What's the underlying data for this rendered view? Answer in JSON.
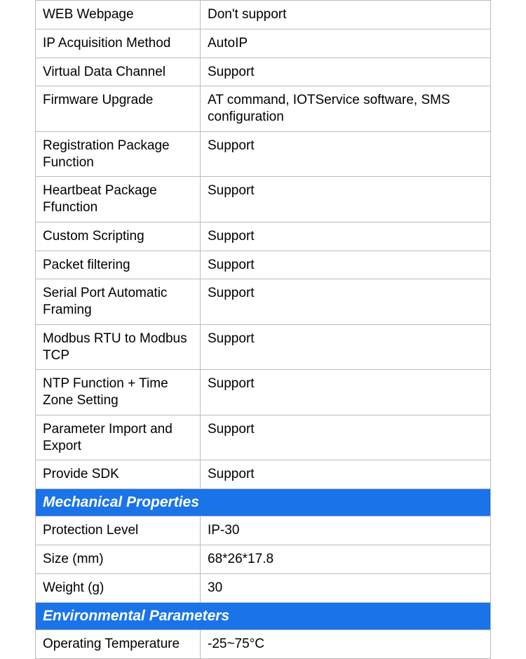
{
  "sections": [
    {
      "header": null,
      "rows": [
        {
          "label": "WEB Webpage",
          "value": "Don't support"
        },
        {
          "label": "IP Acquisition Method",
          "value": "AutoIP"
        },
        {
          "label": "Virtual Data Channel",
          "value": "Support"
        },
        {
          "label": "Firmware Upgrade",
          "value": "AT command, IOTService software, SMS configuration"
        },
        {
          "label": "Registration Package Function",
          "value": "Support"
        },
        {
          "label": "Heartbeat Package Ffunction",
          "value": "Support"
        },
        {
          "label": "Custom Scripting",
          "value": "Support"
        },
        {
          "label": "Packet filtering",
          "value": "Support"
        },
        {
          "label": "Serial Port Automatic Framing",
          "value": "Support"
        },
        {
          "label": "Modbus RTU to Modbus TCP",
          "value": "Support"
        },
        {
          "label": "NTP Function + Time Zone Setting",
          "value": "Support"
        },
        {
          "label": "Parameter Import and Export",
          "value": "Support"
        },
        {
          "label": "Provide SDK",
          "value": "Support"
        }
      ]
    },
    {
      "header": "Mechanical Properties",
      "rows": [
        {
          "label": "Protection Level",
          "value": "IP-30"
        },
        {
          "label": "Size (mm)",
          "value": "68*26*17.8"
        },
        {
          "label": "Weight (g)",
          "value": "30"
        }
      ]
    },
    {
      "header": "Environmental Parameters",
      "rows": [
        {
          "label": "Operating Temperature",
          "value": "-25~75°C"
        }
      ]
    }
  ]
}
